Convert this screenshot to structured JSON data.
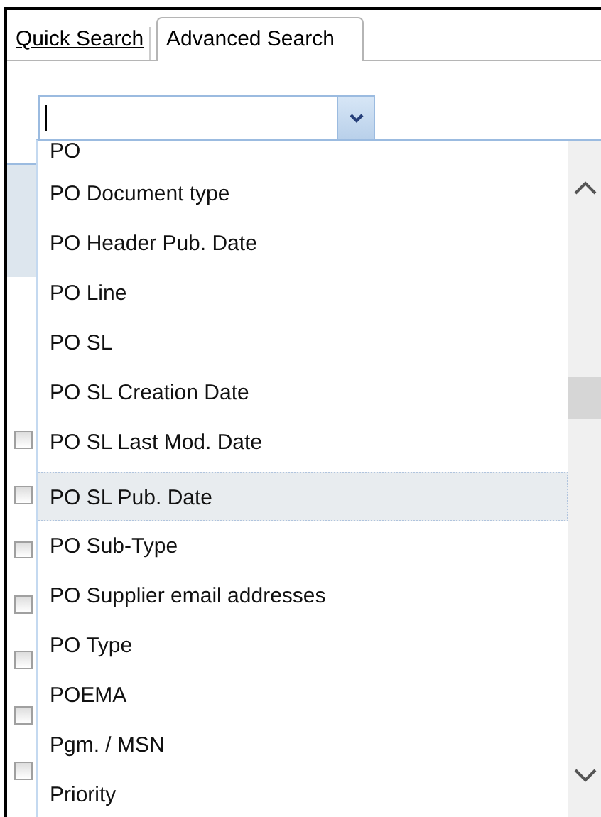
{
  "tabs": [
    {
      "label": "Quick Search",
      "kind": "link",
      "selected": false
    },
    {
      "label": "Advanced Search",
      "kind": "tab",
      "selected": true
    }
  ],
  "combo": {
    "open": true
  },
  "options": [
    {
      "label": "PO",
      "selected": false
    },
    {
      "label": "PO Document type",
      "selected": false
    },
    {
      "label": "PO Header Pub. Date",
      "selected": false
    },
    {
      "label": "PO Line",
      "selected": false
    },
    {
      "label": "PO SL",
      "selected": false
    },
    {
      "label": "PO SL Creation Date",
      "selected": false
    },
    {
      "label": "PO SL Last Mod. Date",
      "selected": false
    },
    {
      "label": "PO SL Pub. Date",
      "selected": true
    },
    {
      "label": "PO Sub-Type",
      "selected": false
    },
    {
      "label": "PO Supplier email addresses",
      "selected": false
    },
    {
      "label": "PO Type",
      "selected": false
    },
    {
      "label": "POEMA",
      "selected": false
    },
    {
      "label": "Pgm. / MSN",
      "selected": false
    },
    {
      "label": "Priority",
      "selected": false
    }
  ],
  "background_checkboxes": [
    {
      "checked": false
    },
    {
      "checked": false
    },
    {
      "checked": false
    },
    {
      "checked": false
    },
    {
      "checked": false
    },
    {
      "checked": false
    },
    {
      "checked": false
    }
  ]
}
